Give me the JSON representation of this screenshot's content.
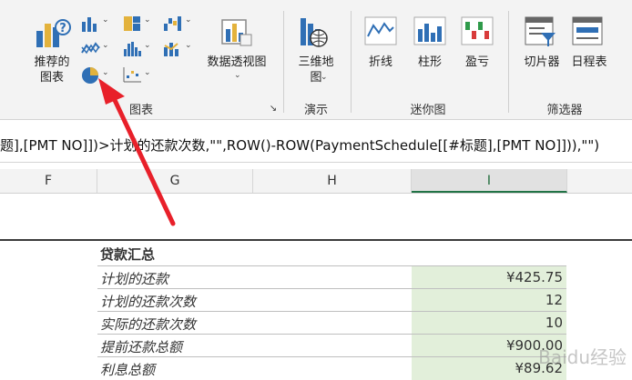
{
  "ribbon": {
    "charts_group": {
      "recommended_label_line1": "推荐的",
      "recommended_label_line2": "图表",
      "pivotchart_label": "数据透视图",
      "group_label": "图表",
      "launcher": "↘"
    },
    "tours_group": {
      "map3d_label_line1": "三维地",
      "map3d_label_line2": "图",
      "group_label": "演示"
    },
    "sparklines_group": {
      "line_label": "折线",
      "column_label": "柱形",
      "winloss_label": "盈亏",
      "group_label": "迷你图"
    },
    "filters_group": {
      "slicer_label": "切片器",
      "timeline_label": "日程表",
      "group_label": "筛选器"
    },
    "dropdown_glyph": "⌄",
    "accent_color": "#217346",
    "icon_blue": "#2f6fb5",
    "icon_gold": "#e3b23c"
  },
  "formula_bar": {
    "text": "题],[PMT NO]])>计划的还款次数,\"\",ROW()-ROW(PaymentSchedule[[#标题],[PMT NO]])),\"\")"
  },
  "columns": [
    "F",
    "G",
    "H",
    "I"
  ],
  "loan_summary": {
    "header": "贷款汇总",
    "rows": [
      {
        "label": "计划的还款",
        "value": "¥425.75"
      },
      {
        "label": "计划的还款次数",
        "value": "12"
      },
      {
        "label": "实际的还款次数",
        "value": "10"
      },
      {
        "label": "提前还款总额",
        "value": "¥900.00"
      },
      {
        "label": "利息总额",
        "value": "¥89.62"
      }
    ]
  },
  "annotation": {
    "arrow_color": "#e8202a"
  },
  "watermark": "Baidu经验"
}
